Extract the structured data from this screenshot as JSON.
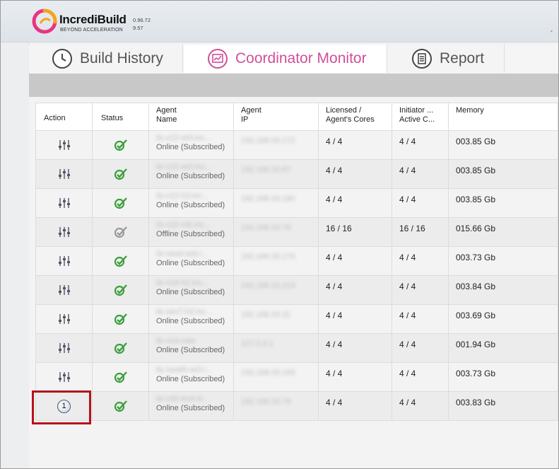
{
  "app": {
    "brand": "IncrediBuild",
    "tagline": "BEYOND ACCELERATION",
    "version_line1": "0.96.72",
    "version_line2": "9.57"
  },
  "tabs": [
    {
      "label": "Build History",
      "icon": "clock-icon",
      "active": false
    },
    {
      "label": "Coordinator Monitor",
      "icon": "monitor-chart-icon",
      "active": true
    },
    {
      "label": "Report",
      "icon": "list-report-icon",
      "active": false
    }
  ],
  "table": {
    "headers": {
      "action": "Action",
      "status": "Status",
      "agent_name_1": "Agent",
      "agent_name_2": "Name",
      "agent_ip_1": "Agent",
      "agent_ip_2": "IP",
      "licensed_1": "Licensed /",
      "licensed_2": "Agent's Cores",
      "initiator_1": "Initiator ...",
      "initiator_2": "Active C...",
      "memory": "Memory"
    },
    "rows": [
      {
        "name": "ilx-v22-wi3.inc...",
        "state": "Online (Subscribed)",
        "ip": "192.168.33.172",
        "licensed": "4 / 4",
        "initiator": "4 / 4",
        "memory": "003.85 Gb",
        "online": true
      },
      {
        "name": "ilx-v22-wi3.inc...",
        "state": "Online (Subscribed)",
        "ip": "192.168.33.67",
        "licensed": "4 / 4",
        "initiator": "4 / 4",
        "memory": "003.85 Gb",
        "online": true
      },
      {
        "name": "ilx-v22-h3.inc...",
        "state": "Online (Subscribed)",
        "ip": "192.168.33.180",
        "licensed": "4 / 4",
        "initiator": "4 / 4",
        "memory": "003.85 Gb",
        "online": true
      },
      {
        "name": "ilx-v22-mb.inc...",
        "state": "Offline (Subscribed)",
        "ip": "192.168.33.76",
        "licensed": "16 / 16",
        "initiator": "16 / 16",
        "memory": "015.66 Gb",
        "online": false
      },
      {
        "name": "ilx-ravel-wi4.i...",
        "state": "Online (Subscribed)",
        "ip": "192.168.33.179",
        "licensed": "4 / 4",
        "initiator": "4 / 4",
        "memory": "003.73 Gb",
        "online": true
      },
      {
        "name": "ilx-v16-h2.inc...",
        "state": "Online (Subscribed)",
        "ip": "192.168.33.213",
        "licensed": "4 / 4",
        "initiator": "4 / 4",
        "memory": "003.84 Gb",
        "online": true
      },
      {
        "name": "ilx-sev7-h3.inc...",
        "state": "Online (Subscribed)",
        "ip": "192.168.33.31",
        "licensed": "4 / 4",
        "initiator": "4 / 4",
        "memory": "003.69 Gb",
        "online": true
      },
      {
        "name": "ilx-v14-vaw",
        "state": "Online (Subscribed)",
        "ip": "127.0.0.1",
        "licensed": "4 / 4",
        "initiator": "4 / 4",
        "memory": "001.94 Gb",
        "online": true
      },
      {
        "name": "ilx-ravel5-wi3.i...",
        "state": "Online (Subscribed)",
        "ip": "192.168.33.169",
        "licensed": "4 / 4",
        "initiator": "4 / 4",
        "memory": "003.73 Gb",
        "online": true
      },
      {
        "name": "ilx-v30-inch-b...",
        "state": "Online (Subscribed)",
        "ip": "192.168.33.79",
        "licensed": "4 / 4",
        "initiator": "4 / 4",
        "memory": "003.83 Gb",
        "online": true,
        "badge": "1"
      }
    ]
  },
  "colors": {
    "accent": "#d0509a",
    "online": "#3aa03a",
    "offline": "#9a9a9a",
    "highlight": "#b5121b"
  }
}
